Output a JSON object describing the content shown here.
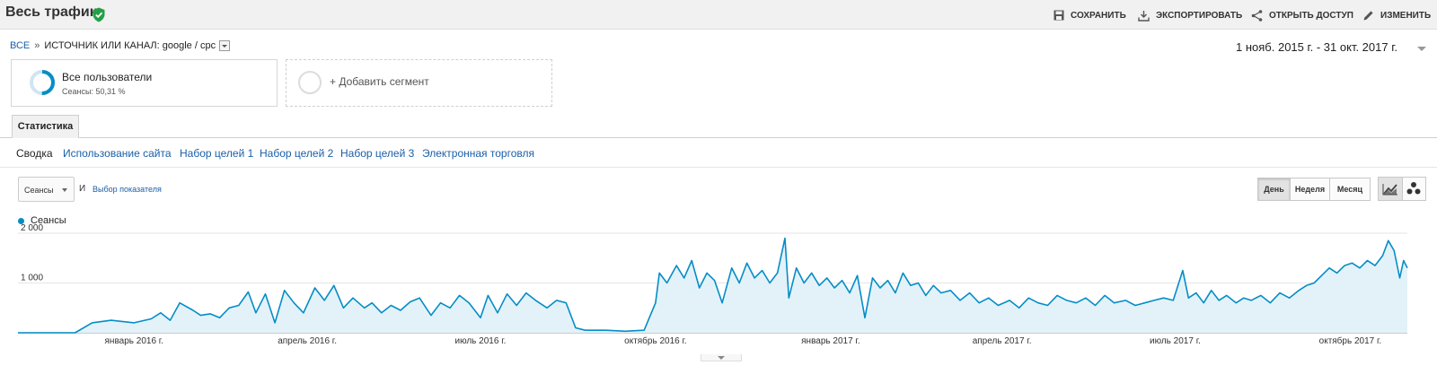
{
  "header": {
    "title": "Весь трафик",
    "actions": [
      {
        "label": "СОХРАНИТЬ",
        "icon": "save-icon"
      },
      {
        "label": "ЭКСПОРТИРОВАТЬ",
        "icon": "export-icon"
      },
      {
        "label": "ОТКРЫТЬ ДОСТУП",
        "icon": "share-icon"
      },
      {
        "label": "ИЗМЕНИТЬ",
        "icon": "edit-icon"
      }
    ]
  },
  "breadcrumb": {
    "root": "ВСЕ",
    "separator": "»",
    "filter": "ИСТОЧНИК ИЛИ КАНАЛ: google / cpc"
  },
  "date_range": "1 нояб. 2015 г. - 31 окт. 2017 г.",
  "segments": {
    "active": {
      "name": "Все пользователи",
      "subtitle": "Сеансы: 50,31 %",
      "share": 0.5031
    },
    "add_label": "+ Добавить сегмент"
  },
  "tabs": {
    "main": "Статистика",
    "sub": [
      "Сводка",
      "Использование сайта",
      "Набор целей 1",
      "Набор целей 2",
      "Набор целей 3",
      "Электронная торговля"
    ]
  },
  "controls": {
    "metric_select": "Сеансы",
    "and_label": "И",
    "choose_metric": "Выбор показателя",
    "granularity": [
      "День",
      "Неделя",
      "Месяц"
    ],
    "selected_granularity": "День"
  },
  "chart_data": {
    "type": "area",
    "legend": [
      "Сеансы"
    ],
    "series_color": "#058dc7",
    "fill_color": "#e3f2f9",
    "ylim": [
      0,
      2000
    ],
    "y_ticks": [
      {
        "value": 2000,
        "label": "2 000"
      },
      {
        "value": 1000,
        "label": "1 000"
      }
    ],
    "x_range": [
      "2015-11-01",
      "2017-10-31"
    ],
    "x_ticks": [
      {
        "date": "2016-01-01",
        "label": "январь 2016 г."
      },
      {
        "date": "2016-04-01",
        "label": "апрель 2016 г."
      },
      {
        "date": "2016-07-01",
        "label": "июль 2016 г."
      },
      {
        "date": "2016-10-01",
        "label": "октябрь 2016 г."
      },
      {
        "date": "2017-01-01",
        "label": "январь 2017 г."
      },
      {
        "date": "2017-04-01",
        "label": "апрель 2017 г."
      },
      {
        "date": "2017-07-01",
        "label": "июль 2017 г."
      },
      {
        "date": "2017-10-01",
        "label": "октябрь 2017 г."
      }
    ],
    "grid": true,
    "legend_position": "top-left",
    "sampling": "approximate readings, roughly one point per 4-5 days",
    "points": [
      [
        "2015-11-01",
        0
      ],
      [
        "2015-12-01",
        0
      ],
      [
        "2015-12-10",
        200
      ],
      [
        "2015-12-20",
        250
      ],
      [
        "2016-01-01",
        200
      ],
      [
        "2016-01-10",
        280
      ],
      [
        "2016-01-15",
        400
      ],
      [
        "2016-01-20",
        250
      ],
      [
        "2016-01-25",
        600
      ],
      [
        "2016-02-01",
        450
      ],
      [
        "2016-02-05",
        350
      ],
      [
        "2016-02-10",
        380
      ],
      [
        "2016-02-15",
        300
      ],
      [
        "2016-02-20",
        500
      ],
      [
        "2016-02-25",
        550
      ],
      [
        "2016-03-01",
        820
      ],
      [
        "2016-03-05",
        400
      ],
      [
        "2016-03-10",
        780
      ],
      [
        "2016-03-15",
        200
      ],
      [
        "2016-03-20",
        850
      ],
      [
        "2016-03-25",
        600
      ],
      [
        "2016-03-30",
        400
      ],
      [
        "2016-04-05",
        900
      ],
      [
        "2016-04-10",
        650
      ],
      [
        "2016-04-15",
        950
      ],
      [
        "2016-04-20",
        500
      ],
      [
        "2016-04-25",
        700
      ],
      [
        "2016-05-01",
        500
      ],
      [
        "2016-05-05",
        600
      ],
      [
        "2016-05-10",
        400
      ],
      [
        "2016-05-15",
        550
      ],
      [
        "2016-05-20",
        450
      ],
      [
        "2016-05-25",
        620
      ],
      [
        "2016-05-30",
        700
      ],
      [
        "2016-06-05",
        350
      ],
      [
        "2016-06-10",
        600
      ],
      [
        "2016-06-15",
        500
      ],
      [
        "2016-06-20",
        750
      ],
      [
        "2016-06-25",
        600
      ],
      [
        "2016-07-01",
        300
      ],
      [
        "2016-07-05",
        750
      ],
      [
        "2016-07-10",
        400
      ],
      [
        "2016-07-15",
        780
      ],
      [
        "2016-07-20",
        550
      ],
      [
        "2016-07-25",
        800
      ],
      [
        "2016-07-30",
        650
      ],
      [
        "2016-08-05",
        500
      ],
      [
        "2016-08-10",
        650
      ],
      [
        "2016-08-15",
        600
      ],
      [
        "2016-08-20",
        100
      ],
      [
        "2016-08-25",
        50
      ],
      [
        "2016-09-05",
        50
      ],
      [
        "2016-09-15",
        30
      ],
      [
        "2016-09-25",
        50
      ],
      [
        "2016-10-01",
        600
      ],
      [
        "2016-10-03",
        1200
      ],
      [
        "2016-10-07",
        1000
      ],
      [
        "2016-10-12",
        1350
      ],
      [
        "2016-10-16",
        1100
      ],
      [
        "2016-10-20",
        1450
      ],
      [
        "2016-10-24",
        900
      ],
      [
        "2016-10-28",
        1200
      ],
      [
        "2016-11-01",
        1050
      ],
      [
        "2016-11-05",
        600
      ],
      [
        "2016-11-10",
        1300
      ],
      [
        "2016-11-14",
        1000
      ],
      [
        "2016-11-18",
        1400
      ],
      [
        "2016-11-22",
        1100
      ],
      [
        "2016-11-26",
        1250
      ],
      [
        "2016-11-30",
        1000
      ],
      [
        "2016-12-04",
        1200
      ],
      [
        "2016-12-08",
        1900
      ],
      [
        "2016-12-10",
        700
      ],
      [
        "2016-12-14",
        1300
      ],
      [
        "2016-12-18",
        1000
      ],
      [
        "2016-12-22",
        1200
      ],
      [
        "2016-12-26",
        950
      ],
      [
        "2016-12-30",
        1100
      ],
      [
        "2017-01-03",
        900
      ],
      [
        "2017-01-07",
        1050
      ],
      [
        "2017-01-11",
        800
      ],
      [
        "2017-01-15",
        1150
      ],
      [
        "2017-01-19",
        300
      ],
      [
        "2017-01-23",
        1100
      ],
      [
        "2017-01-27",
        900
      ],
      [
        "2017-01-31",
        1050
      ],
      [
        "2017-02-04",
        800
      ],
      [
        "2017-02-08",
        1200
      ],
      [
        "2017-02-12",
        950
      ],
      [
        "2017-02-16",
        1000
      ],
      [
        "2017-02-20",
        750
      ],
      [
        "2017-02-24",
        950
      ],
      [
        "2017-02-28",
        800
      ],
      [
        "2017-03-05",
        850
      ],
      [
        "2017-03-10",
        650
      ],
      [
        "2017-03-15",
        800
      ],
      [
        "2017-03-20",
        600
      ],
      [
        "2017-03-25",
        700
      ],
      [
        "2017-03-30",
        550
      ],
      [
        "2017-04-05",
        650
      ],
      [
        "2017-04-10",
        500
      ],
      [
        "2017-04-15",
        700
      ],
      [
        "2017-04-20",
        600
      ],
      [
        "2017-04-25",
        550
      ],
      [
        "2017-04-30",
        750
      ],
      [
        "2017-05-05",
        650
      ],
      [
        "2017-05-10",
        600
      ],
      [
        "2017-05-15",
        700
      ],
      [
        "2017-05-20",
        550
      ],
      [
        "2017-05-25",
        750
      ],
      [
        "2017-05-30",
        600
      ],
      [
        "2017-06-05",
        650
      ],
      [
        "2017-06-10",
        550
      ],
      [
        "2017-06-15",
        600
      ],
      [
        "2017-06-20",
        650
      ],
      [
        "2017-06-25",
        700
      ],
      [
        "2017-06-30",
        650
      ],
      [
        "2017-07-05",
        1250
      ],
      [
        "2017-07-08",
        700
      ],
      [
        "2017-07-12",
        800
      ],
      [
        "2017-07-16",
        600
      ],
      [
        "2017-07-20",
        850
      ],
      [
        "2017-07-24",
        650
      ],
      [
        "2017-07-28",
        750
      ],
      [
        "2017-08-02",
        600
      ],
      [
        "2017-08-06",
        700
      ],
      [
        "2017-08-10",
        650
      ],
      [
        "2017-08-15",
        750
      ],
      [
        "2017-08-20",
        600
      ],
      [
        "2017-08-25",
        800
      ],
      [
        "2017-08-30",
        700
      ],
      [
        "2017-09-04",
        850
      ],
      [
        "2017-09-08",
        950
      ],
      [
        "2017-09-12",
        1000
      ],
      [
        "2017-09-16",
        1150
      ],
      [
        "2017-09-20",
        1300
      ],
      [
        "2017-09-24",
        1200
      ],
      [
        "2017-09-28",
        1350
      ],
      [
        "2017-10-02",
        1400
      ],
      [
        "2017-10-06",
        1300
      ],
      [
        "2017-10-10",
        1450
      ],
      [
        "2017-10-14",
        1350
      ],
      [
        "2017-10-18",
        1550
      ],
      [
        "2017-10-21",
        1850
      ],
      [
        "2017-10-24",
        1650
      ],
      [
        "2017-10-27",
        1100
      ],
      [
        "2017-10-29",
        1450
      ],
      [
        "2017-10-31",
        1300
      ]
    ]
  }
}
